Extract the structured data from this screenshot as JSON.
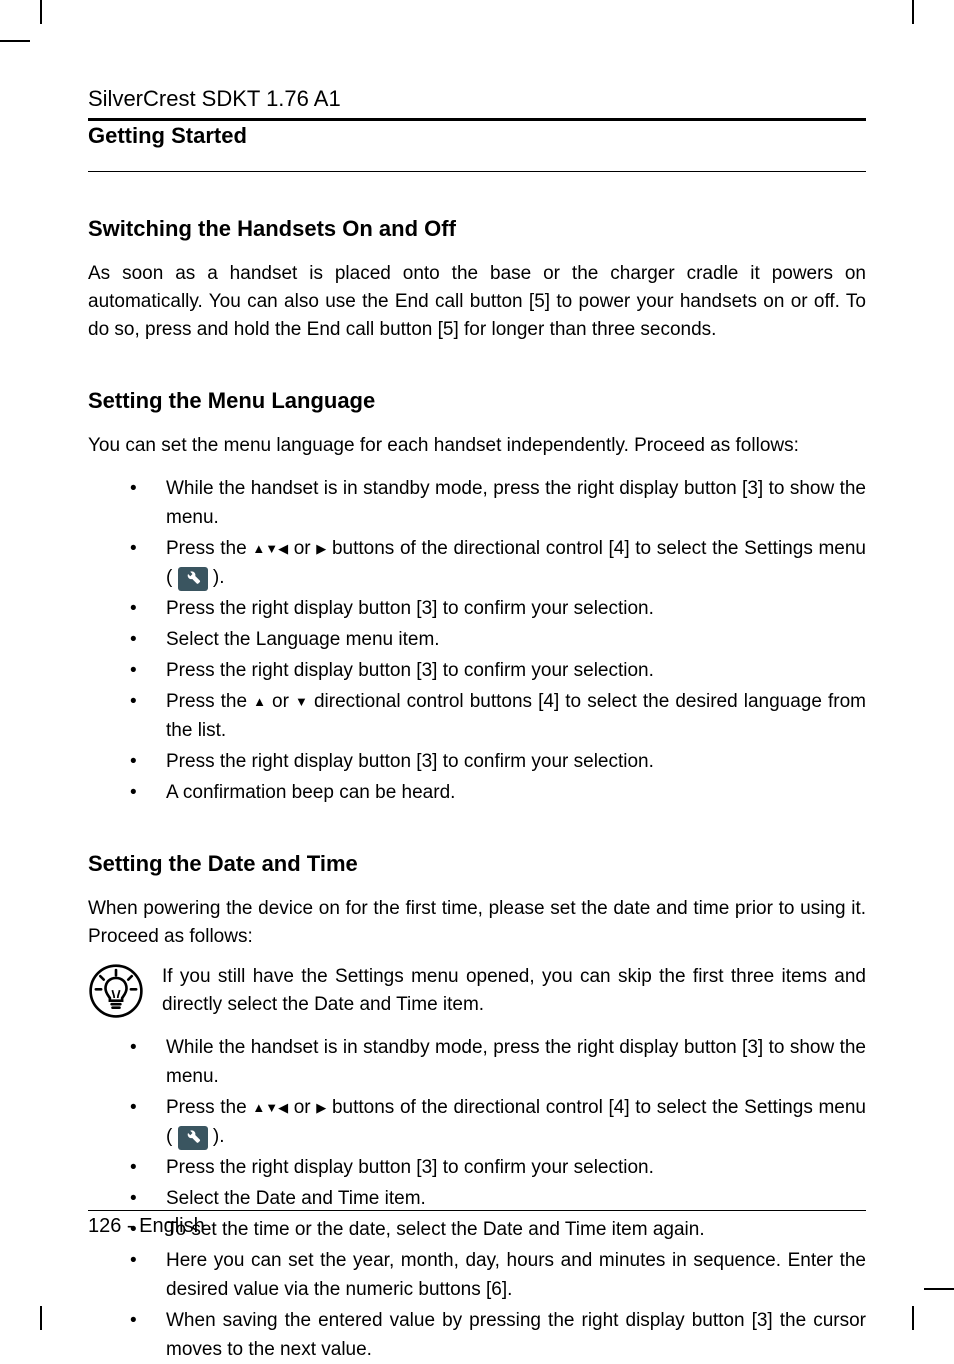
{
  "header": {
    "product": "SilverCrest SDKT 1.76 A1"
  },
  "section_heading": "Getting Started",
  "s1": {
    "title": "Switching the Handsets On and Off",
    "para": "As soon as a handset is placed onto the base or the charger cradle it powers on automatically. You can also use the End call button [5] to power your handsets on or off. To do so, press and hold the End call button [5] for longer than three seconds."
  },
  "s2": {
    "title": "Setting the Menu Language",
    "para": "You can set the menu language for each handset independently. Proceed as follows:",
    "li1": "While the handset is in standby mode, press the right display button [3] to show the menu.",
    "li2a": "Press the ",
    "li2b": " or ",
    "li2c": " buttons of the directional control [4] to select the Settings menu ( ",
    "li2d": " ).",
    "li3": "Press the right display button [3] to confirm your selection.",
    "li4": "Select the Language menu item.",
    "li5": "Press the right display button [3] to confirm your selection.",
    "li6a": "Press the ",
    "li6b": " or ",
    "li6c": " directional control buttons [4] to select the desired language from the list.",
    "li7": "Press the right display button [3] to confirm your selection.",
    "li8": "A confirmation beep can be heard."
  },
  "s3": {
    "title": "Setting the Date and Time",
    "para": "When powering the device on for the first time, please set the date and time prior to using it. Proceed as follows:",
    "tip": "If you still have the Settings menu opened, you can skip the first three items and directly select the Date and Time item.",
    "li1": "While the handset is in standby mode, press the right display button [3] to show the menu.",
    "li2a": "Press the ",
    "li2b": " or ",
    "li2c": " buttons of the directional control [4] to select the Settings menu ( ",
    "li2d": " ).",
    "li3": "Press the right display button [3] to confirm your selection.",
    "li4": "Select the Date and Time item.",
    "li5": "To set the time or the date, select the Date and Time item again.",
    "li6": "Here you can set the year, month, day, hours and minutes in sequence. Enter the desired value via the numeric buttons [6].",
    "li7": "When saving the entered value by pressing the right display button [3] the cursor moves to the next value."
  },
  "footer": {
    "page": "126",
    "sep": "  -  ",
    "lang": "English"
  },
  "glyphs": {
    "up": "▲",
    "down": "▼",
    "left": "◀",
    "right": "▶"
  }
}
